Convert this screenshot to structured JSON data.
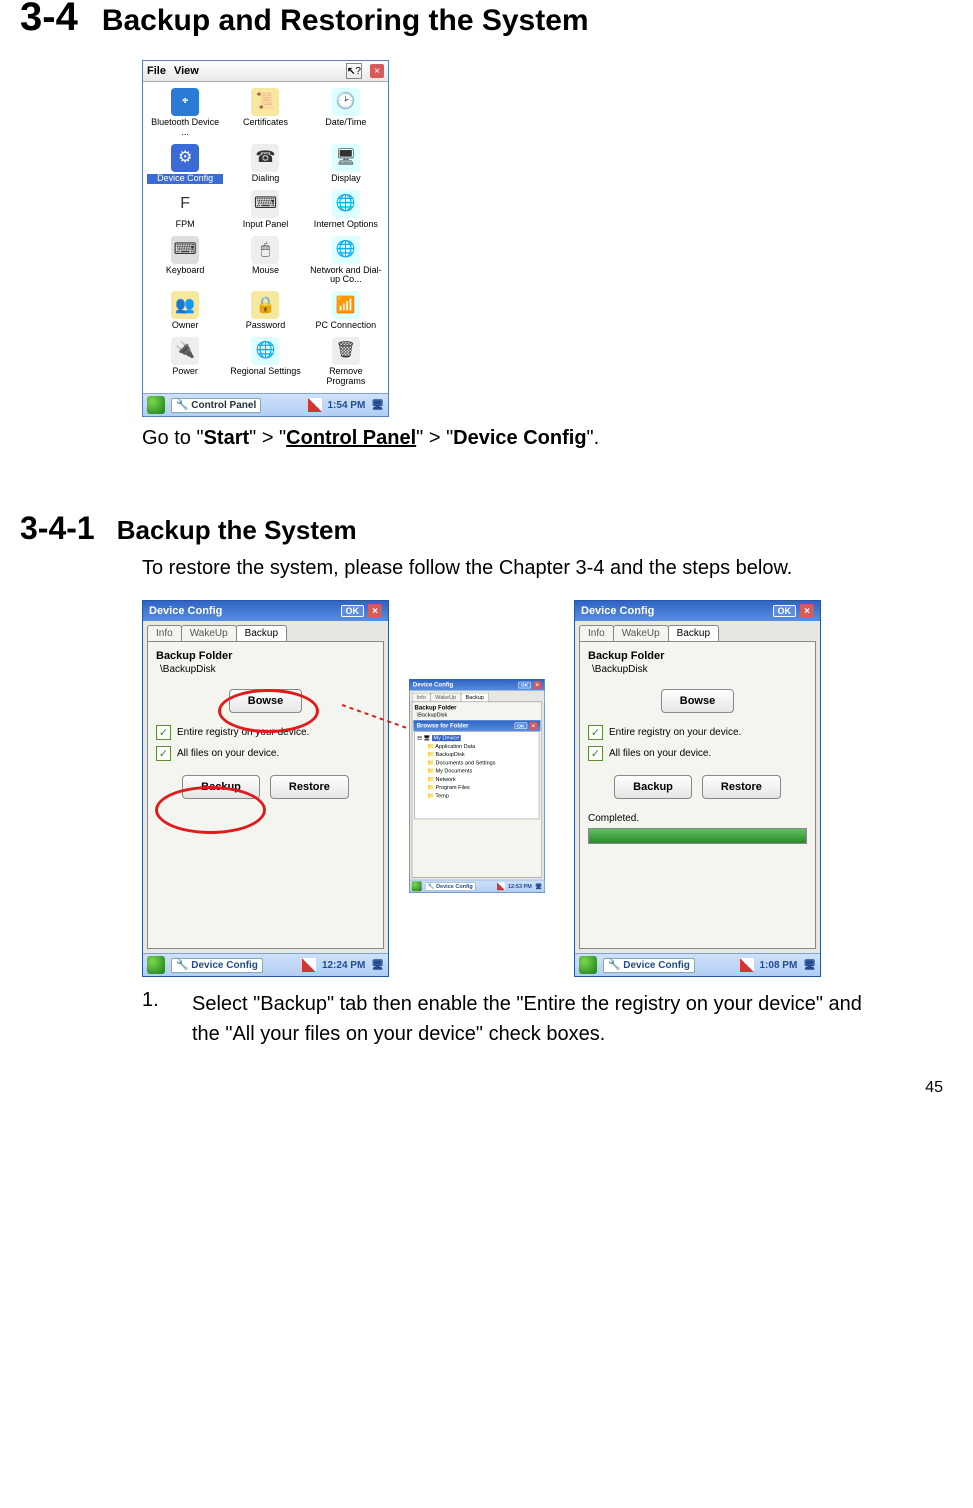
{
  "section": {
    "number": "3-4",
    "title": "Backup and Restoring the System"
  },
  "subsection": {
    "number": "3-4-1",
    "title": "Backup the System"
  },
  "navtext": {
    "prefix": "Go to \"",
    "p1": "Start",
    "s1": "\" > \"",
    "p2": "Control Panel",
    "s2": "\" > \"",
    "p3": "Device Config",
    "s3": "\"."
  },
  "intro2": "To restore the system, please follow the Chapter 3-4 and the steps below.",
  "step1_num": "1.",
  "step1": "Select \"Backup\" tab then enable the \"Entire the registry on your device\" and the \"All your files on your device\" check boxes.",
  "page_number": "45",
  "cp": {
    "menu": {
      "file": "File",
      "view": "View",
      "help": "?",
      "close": "×"
    },
    "items": [
      {
        "label": "Bluetooth Device ...",
        "glyph": "᛭",
        "bg": "#2a7bd6",
        "fg": "#fff"
      },
      {
        "label": "Certificates",
        "glyph": "📜",
        "bg": "#f7e8a0"
      },
      {
        "label": "Date/Time",
        "glyph": "🕑",
        "bg": "#dff"
      },
      {
        "label": "Device Config",
        "glyph": "⚙",
        "bg": "#3a6bd6",
        "fg": "#fff",
        "selected": true
      },
      {
        "label": "Dialing",
        "glyph": "☎",
        "bg": "#eee"
      },
      {
        "label": "Display",
        "glyph": "🖥",
        "bg": "#dff"
      },
      {
        "label": "FPM",
        "glyph": "F",
        "bg": "#fff"
      },
      {
        "label": "Input Panel",
        "glyph": "⌨",
        "bg": "#eee"
      },
      {
        "label": "Internet Options",
        "glyph": "🌐",
        "bg": "#dff"
      },
      {
        "label": "Keyboard",
        "glyph": "⌨",
        "bg": "#ddd"
      },
      {
        "label": "Mouse",
        "glyph": "🖱",
        "bg": "#eee"
      },
      {
        "label": "Network and Dial-up Co...",
        "glyph": "🌐",
        "bg": "#dff"
      },
      {
        "label": "Owner",
        "glyph": "👥",
        "bg": "#f7e8a0"
      },
      {
        "label": "Password",
        "glyph": "🔒",
        "bg": "#f7e8a0"
      },
      {
        "label": "PC Connection",
        "glyph": "📶",
        "bg": "#dff"
      },
      {
        "label": "Power",
        "glyph": "🔌",
        "bg": "#eee"
      },
      {
        "label": "Regional Settings",
        "glyph": "🌐",
        "bg": "#dff"
      },
      {
        "label": "Remove Programs",
        "glyph": "🗑",
        "bg": "#eee"
      }
    ],
    "taskbar": {
      "app": "Control Panel",
      "time": "1:54 PM"
    }
  },
  "dc_left": {
    "title": "Device Config",
    "ok": "OK",
    "tabs": [
      "Info",
      "WakeUp",
      "Backup"
    ],
    "folder_label": "Backup Folder",
    "path": "\\BackupDisk",
    "browse": "Bowse",
    "chk1": "Entire registry on your device.",
    "chk2": "All files on your device.",
    "backup": "Backup",
    "restore": "Restore",
    "taskbar": {
      "app": "Device Config",
      "time": "12:24 PM"
    }
  },
  "dc_mid": {
    "title": "Device Config",
    "ok": "OK",
    "tabs": [
      "Info",
      "WakeUp",
      "Backup"
    ],
    "folder_label": "Backup Folder",
    "path": "\\BackupDisk",
    "browse_title": "Browse for Folder",
    "ok2": "OK",
    "root": "My Device",
    "tree_items": [
      "Application Data",
      "BackupDisk",
      "Documents and Settings",
      "My Documents",
      "Network",
      "Program Files",
      "Temp"
    ],
    "taskbar": {
      "app": "Device Config",
      "time": "12:53 PM"
    }
  },
  "dc_right": {
    "title": "Device Config",
    "ok": "OK",
    "tabs": [
      "Info",
      "WakeUp",
      "Backup"
    ],
    "folder_label": "Backup Folder",
    "path": "\\BackupDisk",
    "browse": "Bowse",
    "chk1": "Entire registry on your device.",
    "chk2": "All files on your device.",
    "backup": "Backup",
    "restore": "Restore",
    "status": "Completed.",
    "taskbar": {
      "app": "Device Config",
      "time": "1:08 PM"
    }
  }
}
